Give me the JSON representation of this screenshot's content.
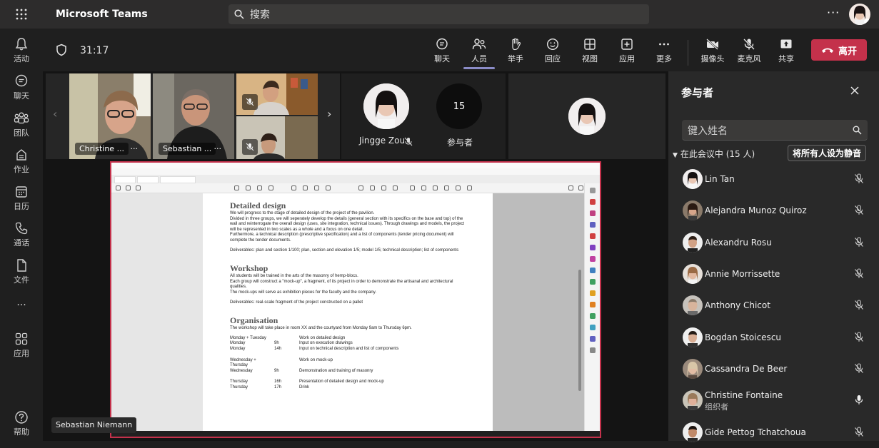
{
  "topbar": {
    "app_title": "Microsoft Teams",
    "search_placeholder": "搜索",
    "more": "···"
  },
  "rail": [
    {
      "label": "活动",
      "icon": "bell-icon"
    },
    {
      "label": "聊天",
      "icon": "chat-icon"
    },
    {
      "label": "团队",
      "icon": "teams-icon"
    },
    {
      "label": "作业",
      "icon": "assignments-icon"
    },
    {
      "label": "日历",
      "icon": "calendar-icon"
    },
    {
      "label": "通话",
      "icon": "phone-icon"
    },
    {
      "label": "文件",
      "icon": "file-icon"
    },
    {
      "label": "···",
      "icon": "more-icon"
    },
    {
      "label": "应用",
      "icon": "apps-icon"
    },
    {
      "label": "帮助",
      "icon": "help-icon"
    }
  ],
  "meeting": {
    "timer": "31:17",
    "toolbar": {
      "chat": "聊天",
      "people": "人员",
      "raise_hand": "举手",
      "reactions": "回应",
      "view": "视图",
      "apps": "应用",
      "more": "更多",
      "camera": "摄像头",
      "mic": "麦克风",
      "share": "共享",
      "leave": "离开"
    },
    "tiles": {
      "christine": "Christine ...",
      "sebastian": "Sebastian ...",
      "more": "···",
      "jingge": "Jingge Zou",
      "participants_count": "15",
      "participants_label": "参与者"
    },
    "speaker_label": "Sebastian Niemann"
  },
  "document": {
    "h1": "Detailed design",
    "p1": "We will progress to the stage of detailed design of the project of the pavilion.",
    "p2": "Divided in three groups, we will seperately develop the details (general section with its specifics on the base and top) of the wall and reinterrogate the overall design (uses, site integration, technical issues). Through drawings and models, the project will be represented in two scales as a whole and a focus on one detail.",
    "p3": "Furthermore, a technical description (prescriptive specification) and a list of components (tender pricing document) will complete the tender documents.",
    "p4": "Deliverables: plan and section 1/100; plan, section and elevation 1/5; model 1/5; technical description; list of components",
    "h2": "Workshop",
    "p5": "All students will be trained in the arts of the masonry of hemp-blocs.",
    "p6": "Each group will construct a \"mock-up\", a fragment, of its project in order to demonstrate the artisanal and architectural qualities.",
    "p7": "The mock-ups will serve as exhibition pieces for the faculty and the company.",
    "p8": "Deliverables: real-scale fragment of the project constructed on a pallet",
    "h3": "Organisation",
    "p9": "The workshop will take place in room XX and the courtyard from Monday 9am to Thursday 6pm.",
    "schedule": [
      [
        "Monday + Tuesday",
        "",
        "Work on detailed design"
      ],
      [
        "Monday",
        "9h",
        "Input on execution drawings"
      ],
      [
        "Monday",
        "14h",
        "Input on technical description and list of components"
      ],
      [
        "",
        "",
        ""
      ],
      [
        "Wednesday + Thursday",
        "",
        "Work on mock-up"
      ],
      [
        "Wednesday",
        "9h",
        "Demonstration and training of masonry"
      ],
      [
        "",
        "",
        ""
      ],
      [
        "Thursday",
        "16h",
        "Presentation of detailed design and mock-up"
      ],
      [
        "Thursday",
        "17h",
        "Drink"
      ]
    ]
  },
  "panel": {
    "title": "参与者",
    "name_placeholder": "键入姓名",
    "section": "在此会议中 (15 人)",
    "mute_all": "将所有人设为静音",
    "participants": [
      {
        "name": "Lin Tan",
        "role": "",
        "muted": true
      },
      {
        "name": "Alejandra Munoz Quiroz",
        "role": "",
        "muted": true
      },
      {
        "name": "Alexandru Rosu",
        "role": "",
        "muted": true
      },
      {
        "name": "Annie Morrissette",
        "role": "",
        "muted": true
      },
      {
        "name": "Anthony Chicot",
        "role": "",
        "muted": true
      },
      {
        "name": "Bogdan Stoicescu",
        "role": "",
        "muted": true
      },
      {
        "name": "Cassandra De Beer",
        "role": "",
        "muted": true
      },
      {
        "name": "Christine Fontaine",
        "role": "组织者",
        "muted": false
      },
      {
        "name": "Gide Pettog Tchatchoua",
        "role": "",
        "muted": true
      }
    ]
  }
}
